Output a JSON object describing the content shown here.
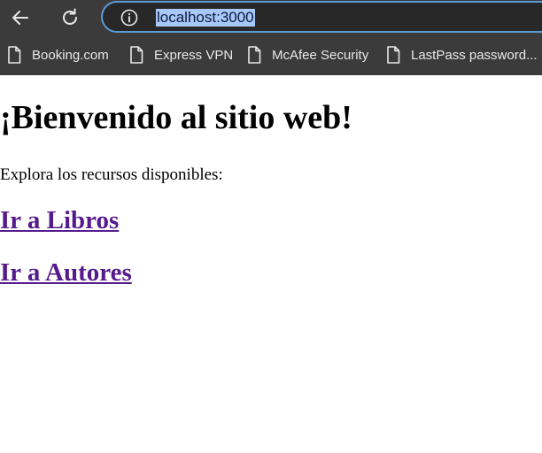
{
  "browser": {
    "url": "localhost:3000",
    "bookmarks": [
      {
        "label": "Booking.com"
      },
      {
        "label": "Express VPN"
      },
      {
        "label": "McAfee Security"
      },
      {
        "label": "LastPass password..."
      }
    ],
    "colors": {
      "toolbar": "#3b3b3b",
      "address_bar": "#282828",
      "address_focus_border": "#5a9bd5",
      "url_selection": "#a8c7fa"
    }
  },
  "page": {
    "title": "¡Bienvenido al sitio web!",
    "intro": "Explora los recursos disponibles:",
    "links": [
      {
        "label": "Ir a Libros"
      },
      {
        "label": "Ir a Autores"
      }
    ],
    "colors": {
      "visited_link": "#551a8b"
    }
  }
}
